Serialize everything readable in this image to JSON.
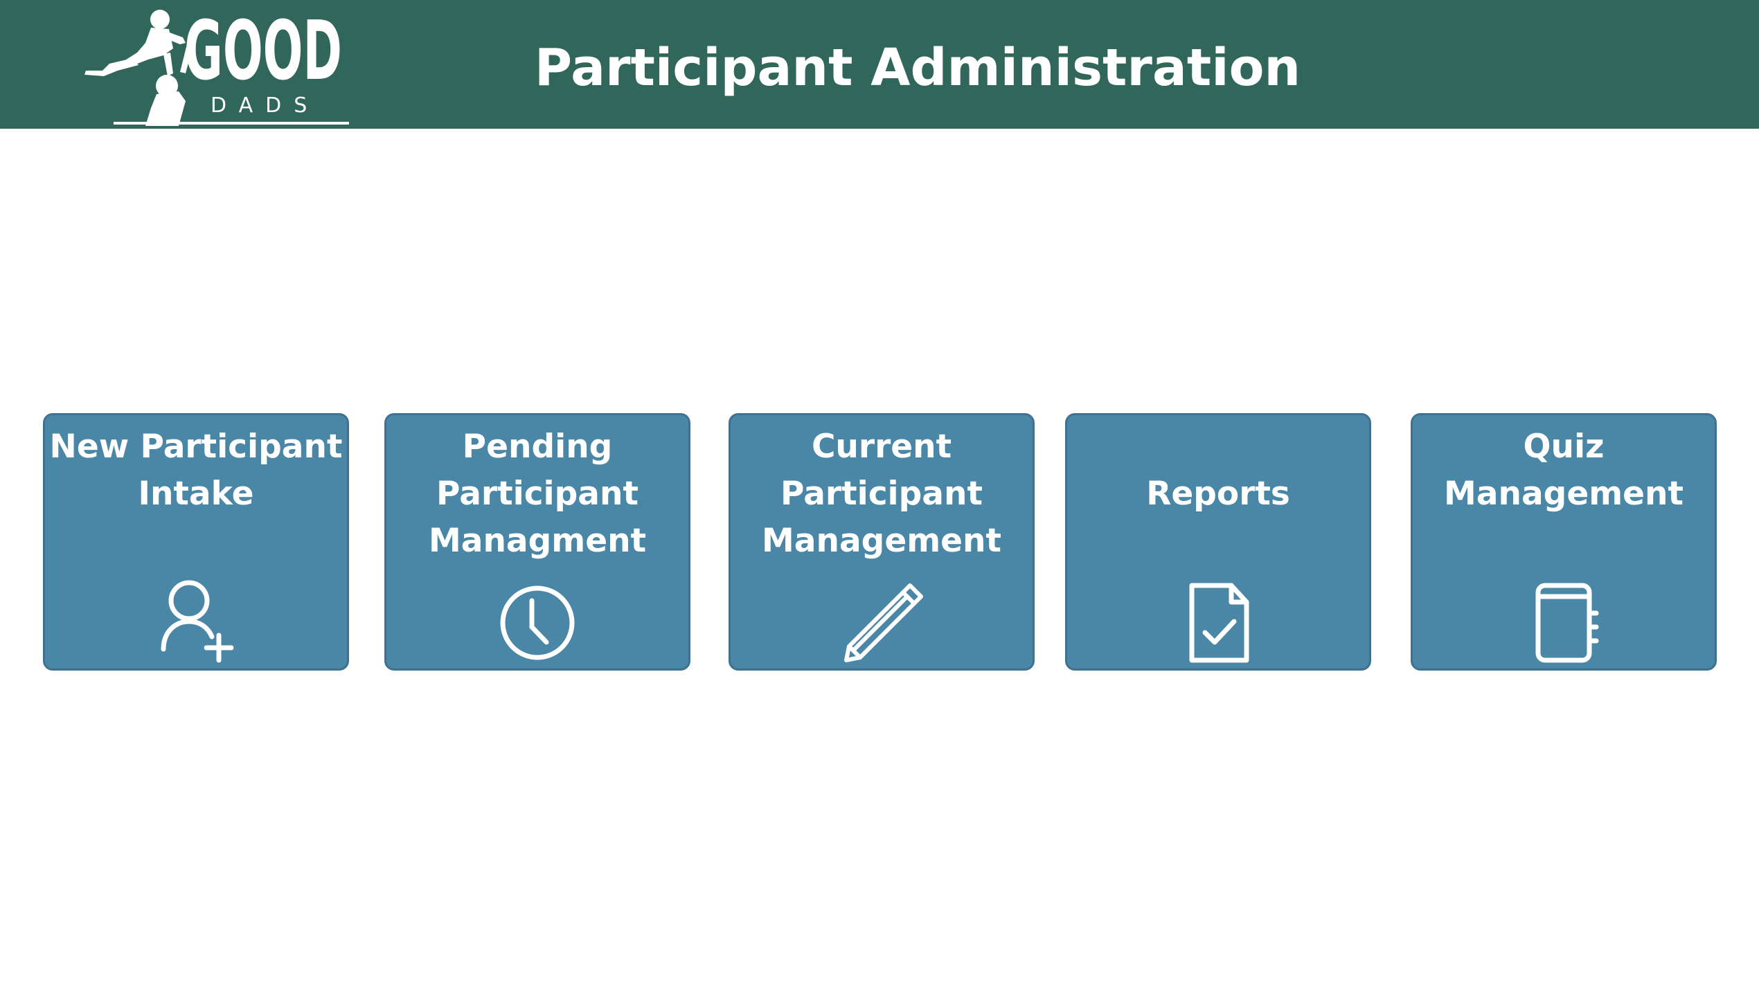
{
  "header": {
    "title": "Participant Administration",
    "logo": {
      "word_top": "GOOD",
      "word_bottom": "DADS"
    }
  },
  "colors": {
    "header_bg": "#31665a",
    "tile_bg": "#4a86a6",
    "tile_border": "#3f7290",
    "text": "#ffffff"
  },
  "tiles": [
    {
      "label": "New Participant\nIntake",
      "icon": "add-user-icon"
    },
    {
      "label": "Pending\nParticipant\nManagment",
      "icon": "clock-icon"
    },
    {
      "label": "Current\nParticipant\nManagement",
      "icon": "pencil-icon"
    },
    {
      "label": "Reports",
      "icon": "document-check-icon"
    },
    {
      "label": "Quiz\nManagement",
      "icon": "notebook-icon"
    }
  ]
}
